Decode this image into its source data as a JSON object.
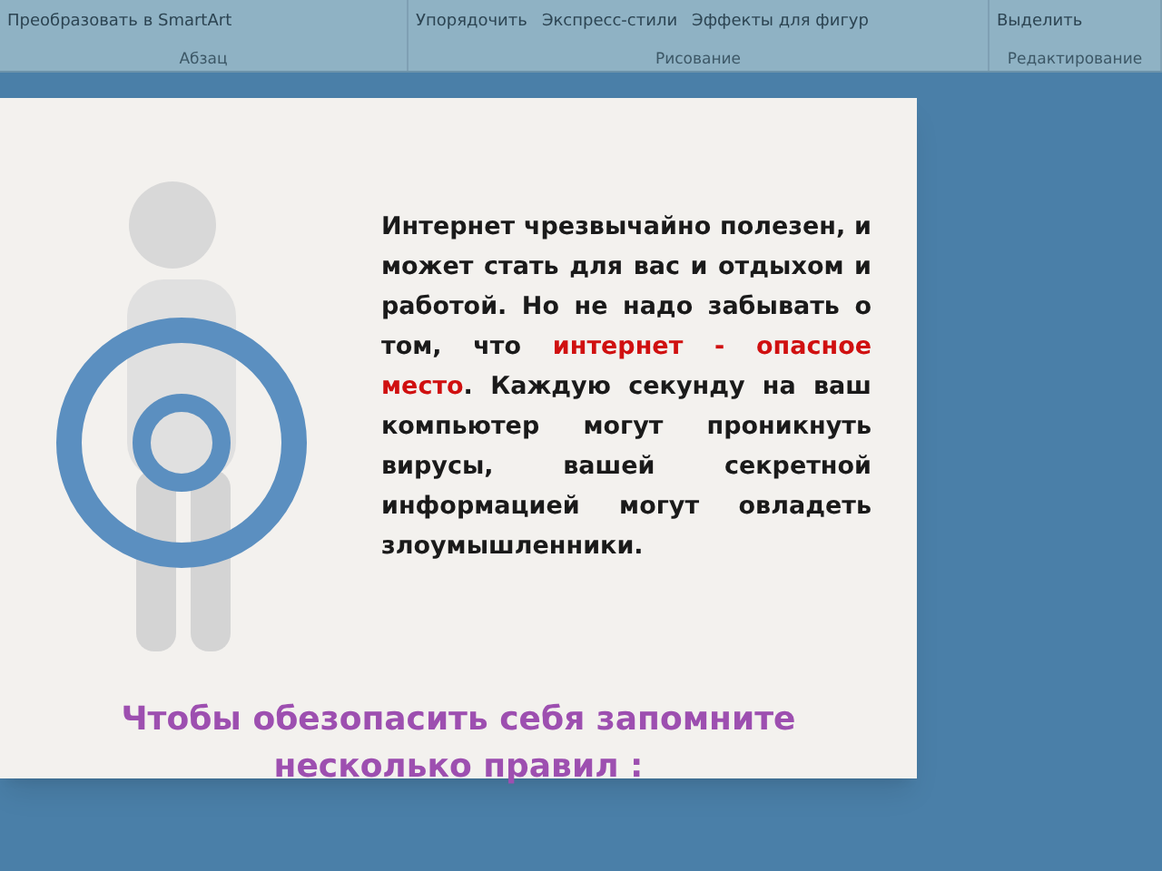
{
  "ribbon": {
    "groups": [
      {
        "label": "Абзац",
        "buttons": [
          "Преобразовать в SmartArt"
        ]
      },
      {
        "label": "Рисование",
        "buttons": [
          "Упорядочить",
          "Экспресс-стили",
          "Эффекты для фигур"
        ]
      },
      {
        "label": "Редактирование",
        "buttons": [
          "Выделить"
        ]
      }
    ]
  },
  "slide": {
    "body": [
      {
        "text": "Интернет чрезвычайно полезен, и может стать для вас и отдыхом и работой. Но не надо забывать о том, что ",
        "highlight": false
      },
      {
        "text": "интернет - опасное место",
        "highlight": true
      },
      {
        "text": ". Каждую секунду на ваш компьютер могут проникнуть вирусы, вашей секретной информацией могут овладеть злоумышленники.",
        "highlight": false
      }
    ],
    "heading": "Чтобы обезопасить себя запомните несколько правил :"
  }
}
